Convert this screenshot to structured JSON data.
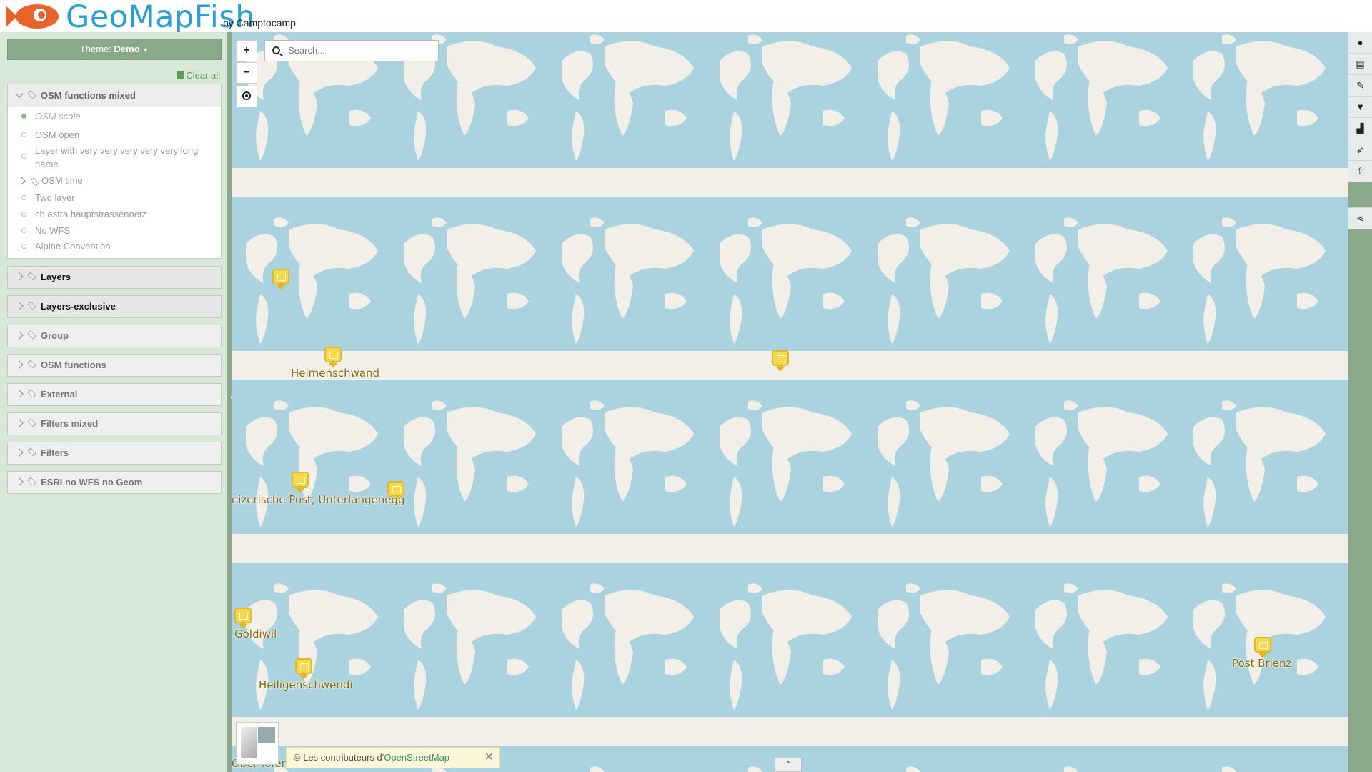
{
  "header": {
    "logo_text": "GeoMapFish",
    "by_text": "by Camptocamp"
  },
  "sidebar": {
    "theme_prefix": "Theme:",
    "theme_value": "Demo",
    "clear_all": "Clear all",
    "open_group": {
      "title": "OSM functions mixed",
      "items": [
        "OSM scale",
        "OSM open",
        "Layer with very very very very very long",
        "name",
        "OSM time",
        "Two layer",
        "ch.astra.hauptstrassennetz",
        "No WFS",
        "Alpine Convention"
      ]
    },
    "groups": [
      "Layers",
      "Layers-exclusive",
      "Group",
      "OSM functions",
      "External",
      "Filters mixed",
      "Filters",
      "ESRI no WFS no Geom"
    ]
  },
  "map": {
    "search_placeholder": "Search...",
    "zoom_in": "+",
    "zoom_out": "−",
    "labels": [
      "Heimenschwand",
      "eizerische Post, Unterlangenegg",
      "Goldiwil",
      "Heiligenschwendi",
      "Post Brienz",
      "Oberhofen"
    ],
    "attribution_prefix": "© Les contributeurs d'",
    "attribution_link": "OpenStreetMap",
    "attribution_close": "✕",
    "bottom_toggle": "⌃"
  },
  "toolbar": {
    "icons": [
      "user-icon",
      "print-icon",
      "draw-icon",
      "filter-icon",
      "profile-icon",
      "editing-icon",
      "import-icon",
      "share-icon"
    ]
  }
}
